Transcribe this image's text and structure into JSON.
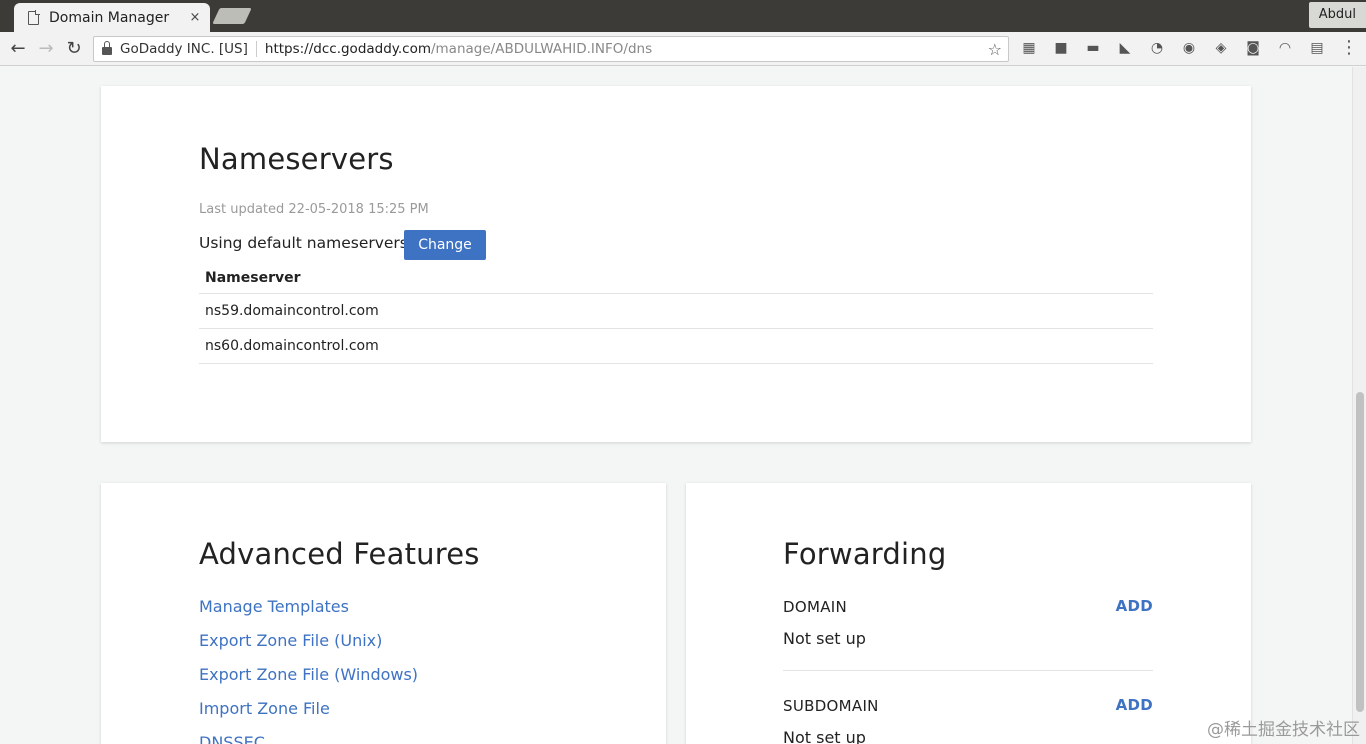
{
  "browser": {
    "tab_title": "Domain Manager",
    "tab_close": "×",
    "profile_name": "Abdul",
    "site_identity": "GoDaddy INC. [US]",
    "url_host": "https://dcc.godaddy.com",
    "url_path": "/manage/ABDULWAHID.INFO/dns",
    "back_icon": "←",
    "forward_icon": "→",
    "reload_icon": "↻",
    "bookmark_icon": "☆",
    "menu_icon": "⋮",
    "extensions": [
      {
        "name": "ext-image-icon",
        "glyph": "▦"
      },
      {
        "name": "ext-page-icon",
        "glyph": "■"
      },
      {
        "name": "ext-folder-icon",
        "glyph": "▬"
      },
      {
        "name": "ext-cat-icon",
        "glyph": "◣"
      },
      {
        "name": "ext-mouse-icon",
        "glyph": "◔"
      },
      {
        "name": "ext-globe-icon",
        "glyph": "◉"
      },
      {
        "name": "ext-shield-icon",
        "glyph": "◈"
      },
      {
        "name": "ext-camera-icon",
        "glyph": "◙"
      },
      {
        "name": "ext-gauge-icon",
        "glyph": "◠"
      },
      {
        "name": "ext-chart-icon",
        "glyph": "▤"
      }
    ]
  },
  "nameservers": {
    "title": "Nameservers",
    "last_updated": "Last updated 22-05-2018 15:25 PM",
    "using_text": "Using default nameservers",
    "change_label": "Change",
    "column_header": "Nameserver",
    "rows": [
      "ns59.domaincontrol.com",
      "ns60.domaincontrol.com"
    ]
  },
  "advanced": {
    "title": "Advanced Features",
    "links": [
      "Manage Templates",
      "Export Zone File (Unix)",
      "Export Zone File (Windows)",
      "Import Zone File",
      "DNSSEC"
    ]
  },
  "forwarding": {
    "title": "Forwarding",
    "domain_label": "DOMAIN",
    "domain_add": "ADD",
    "domain_value": "Not set up",
    "subdomain_label": "SUBDOMAIN",
    "subdomain_add": "ADD",
    "subdomain_value": "Not set up"
  },
  "watermark": "@稀土掘金技术社区"
}
